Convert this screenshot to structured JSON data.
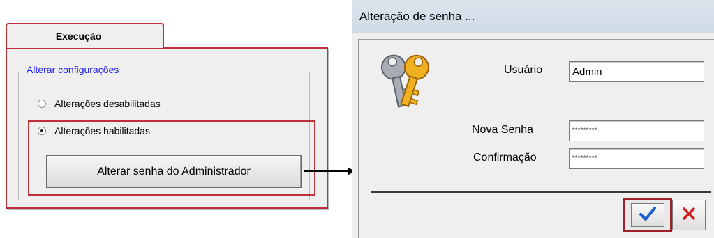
{
  "left_panel": {
    "tab_label": "Execução",
    "group_title": "Alterar configurações",
    "options": [
      {
        "label": "Alterações desabilitadas",
        "selected": false
      },
      {
        "label": "Alterações habilitadas",
        "selected": true
      }
    ],
    "admin_button_label": "Alterar senha do Administrador",
    "highlight_color": "#c0303a",
    "group_title_color": "#2020ee"
  },
  "dialog": {
    "title": "Alteração de senha ...",
    "icon": "keys-icon",
    "user_label": "Usuário",
    "user_value": "Admin",
    "new_password_label": "Nova Senha",
    "new_password_value": "*********",
    "confirm_label": "Confirmação",
    "confirm_value": "*********",
    "ok_icon": "check-icon",
    "cancel_icon": "close-icon",
    "ok_color": "#1e5fd0",
    "cancel_color": "#d02020"
  }
}
